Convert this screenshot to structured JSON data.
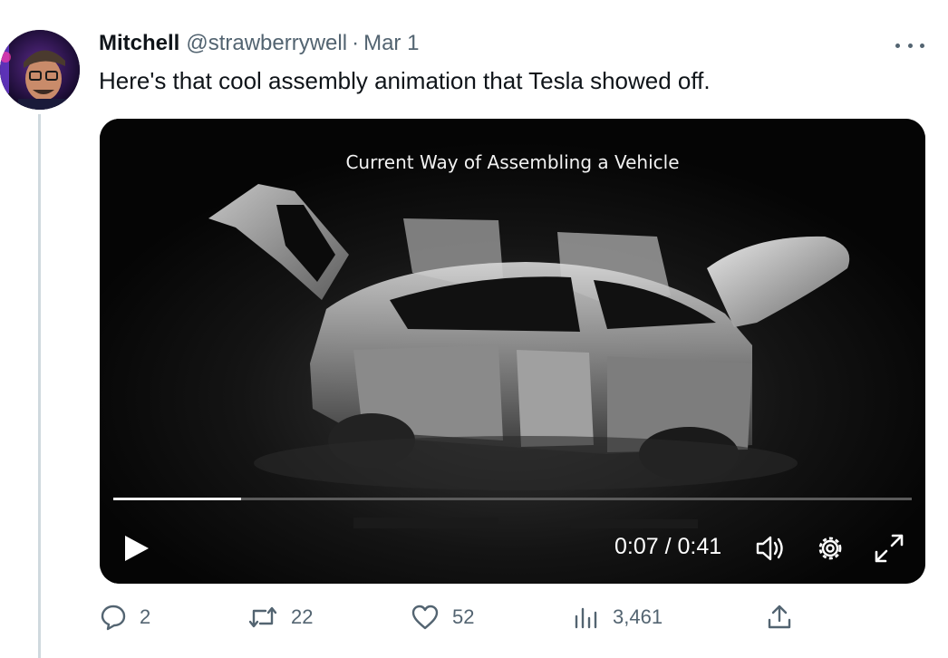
{
  "tweet": {
    "author_name": "Mitchell",
    "handle": "@strawberrywell",
    "separator": "·",
    "date": "Mar 1",
    "text": "Here's that cool assembly animation that Tesla showed off."
  },
  "video": {
    "caption": "Current Way of Assembling a Vehicle",
    "current_time": "0:07",
    "duration": "0:41",
    "time_display": "0:07 / 0:41",
    "progress_fraction": 0.16
  },
  "actions": {
    "replies": "2",
    "retweets": "22",
    "likes": "52",
    "views": "3,461"
  },
  "icons": {
    "more": "more-horizontal-icon",
    "play": "play-icon",
    "volume": "volume-icon",
    "settings": "gear-icon",
    "fullscreen": "fullscreen-icon",
    "reply": "reply-icon",
    "retweet": "retweet-icon",
    "like": "heart-icon",
    "views": "analytics-icon",
    "share": "share-icon"
  },
  "colors": {
    "text_primary": "#0f1419",
    "text_secondary": "#536471",
    "thread_line": "#cfd9de"
  }
}
